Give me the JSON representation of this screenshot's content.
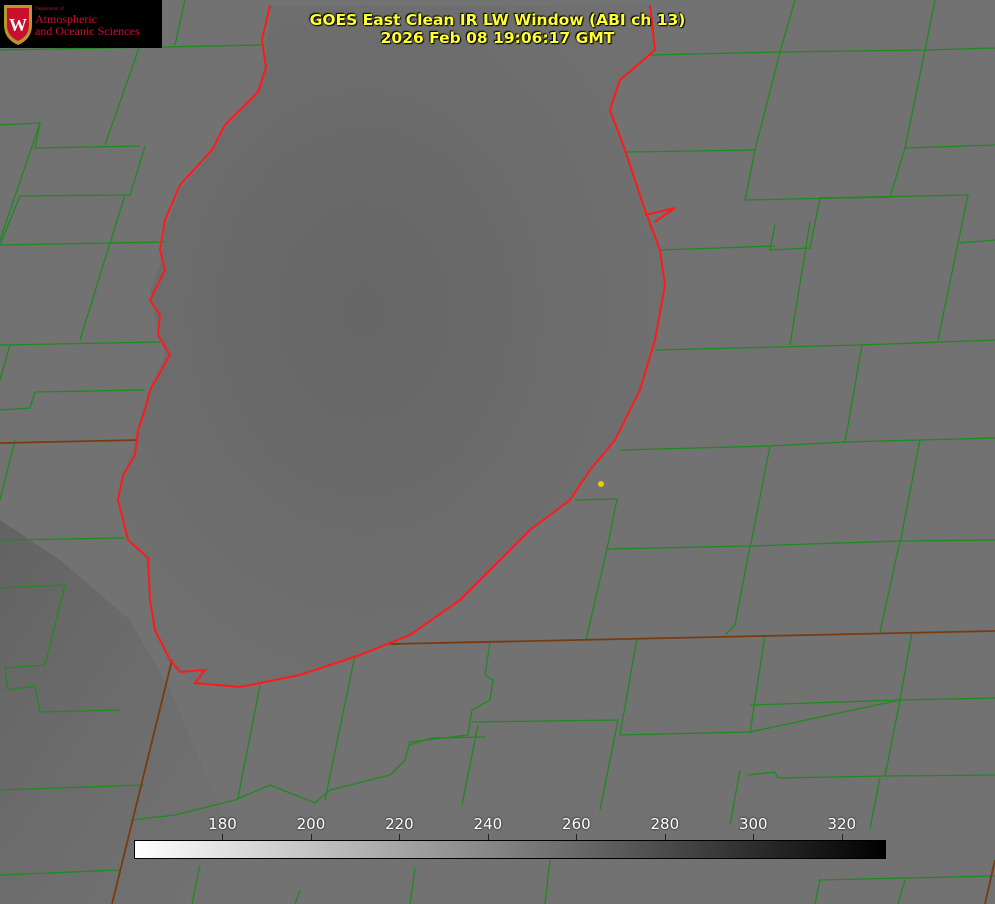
{
  "title_line1": "GOES East Clean IR LW Window (ABI ch 13)",
  "title_line2": "2026 Feb 08 19:06:17 GMT",
  "logo": {
    "small": "Department of",
    "line1": "Atmospheric",
    "line2": "and Oceanic Sciences",
    "crest_letter": "W"
  },
  "colorbar": {
    "min": 160,
    "max": 330,
    "ticks": [
      "180",
      "200",
      "220",
      "240",
      "260",
      "280",
      "300",
      "320"
    ],
    "colors": {
      "low": "#ffffff",
      "high": "#000000"
    }
  },
  "colors": {
    "background": "#727272",
    "county_lines": "#1f8a1f",
    "coastline": "#ff1a1a",
    "state_lines": "#7a3a10",
    "title": "#ffff33",
    "marker": "#e6cc00"
  }
}
